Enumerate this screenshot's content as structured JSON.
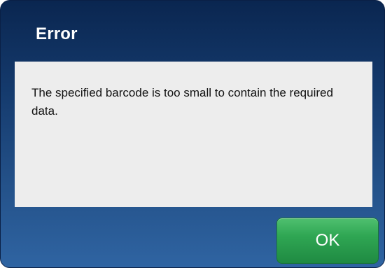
{
  "dialog": {
    "title": "Error",
    "message": "The specified barcode is too small to contain the required data.",
    "ok_label": "OK"
  },
  "colors": {
    "header_gradient_top": "#0a2650",
    "header_gradient_bottom": "#2f64a2",
    "message_panel_bg": "#ededed",
    "ok_button_green": "#2fa653"
  }
}
